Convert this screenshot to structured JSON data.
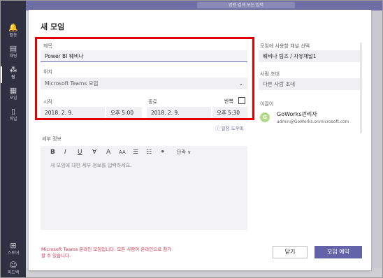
{
  "rail": {
    "items": [
      {
        "label": "활동",
        "icon": "bell-icon",
        "glyph": "🔔"
      },
      {
        "label": "채팅",
        "icon": "chat-icon",
        "glyph": "▤"
      },
      {
        "label": "팀",
        "icon": "teams-icon",
        "glyph": "⁂"
      },
      {
        "label": "모임",
        "icon": "calendar-icon",
        "glyph": "▦"
      },
      {
        "label": "파일",
        "icon": "file-icon",
        "glyph": "▯"
      }
    ],
    "bottom": [
      {
        "label": "스토어",
        "icon": "store-icon",
        "glyph": "⊞"
      },
      {
        "label": "피드백",
        "icon": "feedback-icon",
        "glyph": "☺"
      }
    ]
  },
  "topbar": {
    "search_text": "명령 검색 또는 입력"
  },
  "dialog": {
    "title": "새 모임",
    "title_label": "제목",
    "title_value": "Power BI 웨비나",
    "location_label": "위치",
    "location_value": "Microsoft Teams 모임",
    "start_label": "시작",
    "start_date": "2018. 2. 9.",
    "start_time": "오후 5:00",
    "end_label": "종료",
    "end_date": "2018. 2. 9.",
    "end_time": "오후 5:30",
    "repeat_label": "반복",
    "repeat_checked": false,
    "help_link": "ⓘ 일정 도우미",
    "details_label": "세부 정보",
    "details_placeholder": "새 모임에 대한 세부 정보를 입력하세요.",
    "toolbar": {
      "bold": "B",
      "italic": "I",
      "underline": "U",
      "strike": "∀",
      "highlight": "A",
      "fontsize": "AA",
      "bullets": "☰",
      "numbers": "☷",
      "link": "⚭",
      "paragraph": "단락 ∨"
    },
    "channel_label": "모임에 사용할 채널 선택",
    "channel_value": "웨비나 팀즈 / 자유채널1",
    "invite_label": "사람 초대",
    "invite_placeholder": "다른 사람 초대",
    "invitee_label": "이끌이",
    "attendee": {
      "initial": "G",
      "name": "GoWorks관리자",
      "email": "admin@GoWorks.onmicrosoft.com"
    },
    "footer_note_line1": "Microsoft Teams 온라인 모임입니다. 모든 사람이 온라인으로 참가",
    "footer_note_line2": "할 수 있습니다.",
    "close_label": "닫기",
    "submit_label": "모임 예약"
  },
  "colors": {
    "accent": "#6264a7",
    "rail": "#2f3042",
    "highlight_border": "#e00000",
    "note_red": "#c4314b"
  }
}
